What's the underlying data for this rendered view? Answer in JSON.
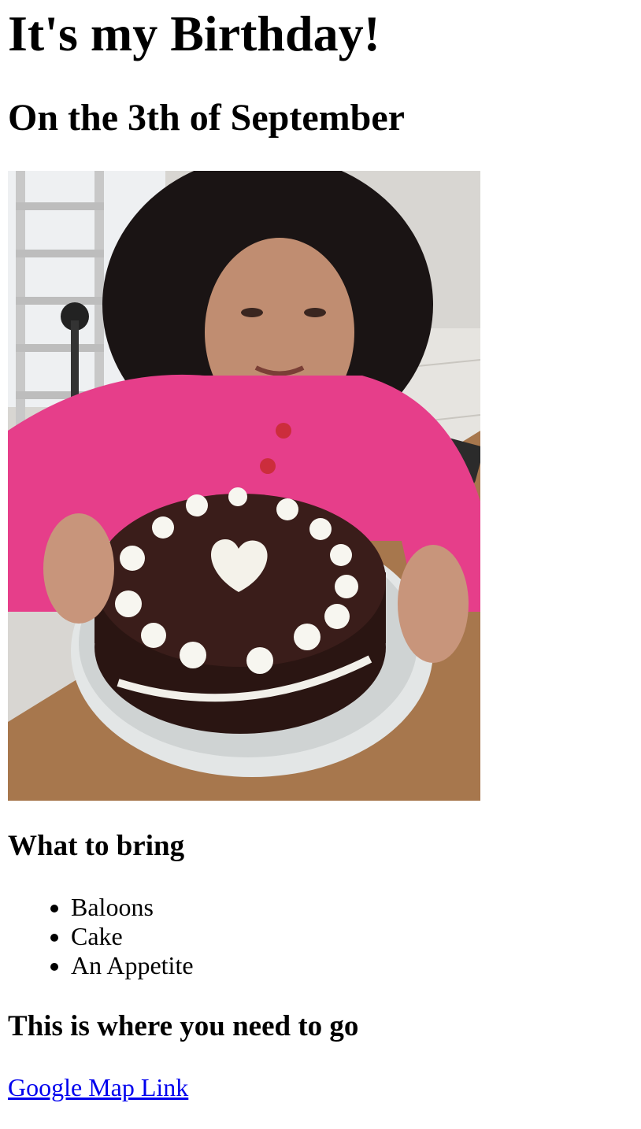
{
  "heading": "It's my Birthday!",
  "subheading": "On the 3th of September",
  "photo": {
    "alt": "birthday cake photo"
  },
  "bring": {
    "title": "What to bring",
    "items": [
      "Baloons",
      "Cake",
      "An Appetite"
    ]
  },
  "location": {
    "title": "This is where you need to go",
    "link_text": "Google Map Link"
  }
}
